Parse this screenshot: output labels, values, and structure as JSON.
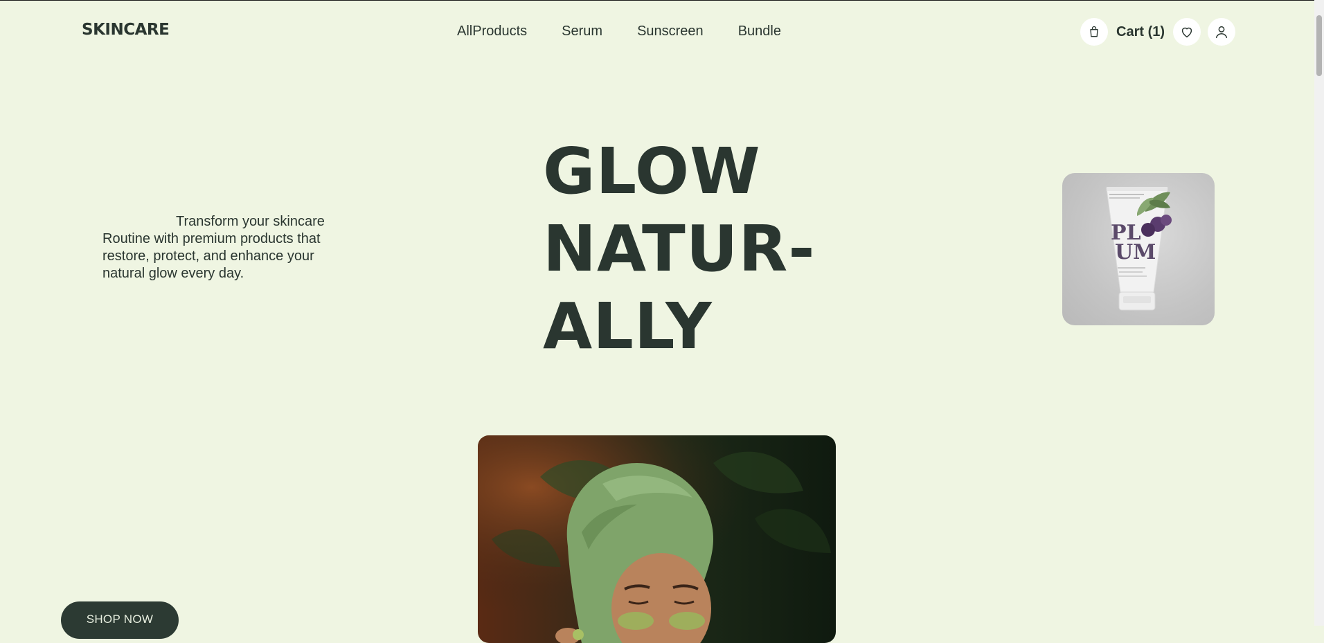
{
  "header": {
    "logo": "SKINCARE",
    "nav": [
      {
        "label": "AllProducts"
      },
      {
        "label": "Serum"
      },
      {
        "label": "Sunscreen"
      },
      {
        "label": "Bundle"
      }
    ],
    "cart_label": "Cart (1)",
    "icons": [
      "shopping-bag-icon",
      "heart-icon",
      "user-icon"
    ]
  },
  "hero": {
    "description": "Transform your skincare Routine with premium products that restore, protect, and enhance your natural glow every day.",
    "headline_lines": [
      "GLOW",
      "NATUR-",
      "ALLY"
    ],
    "product_tube_text_line1": "PL",
    "product_tube_text_line2": "UM",
    "shop_button": "SHOP NOW"
  },
  "colors": {
    "background": "#eff5e2",
    "text": "#2a3630",
    "button": "#2c3a33",
    "towel": "#7fa46a"
  }
}
